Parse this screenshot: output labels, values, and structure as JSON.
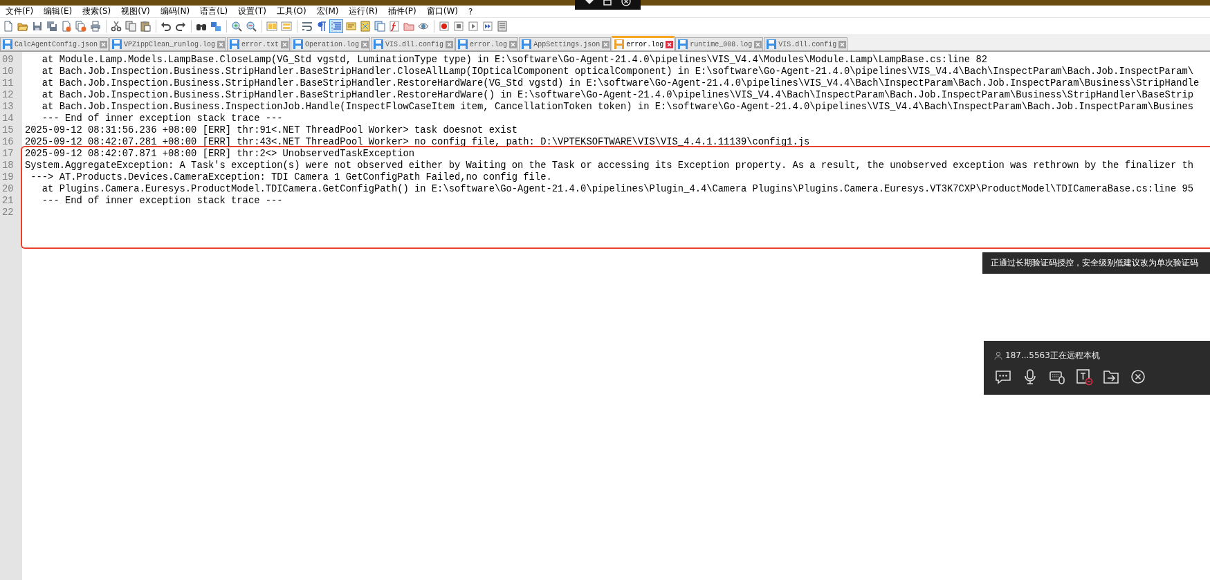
{
  "menu": [
    "文件(F)",
    "编辑(E)",
    "搜索(S)",
    "视图(V)",
    "编码(N)",
    "语言(L)",
    "设置(T)",
    "工具(O)",
    "宏(M)",
    "运行(R)",
    "插件(P)",
    "窗口(W)",
    "?"
  ],
  "toolbar": [
    {
      "pressed": false
    },
    {
      "pressed": false
    },
    {
      "pressed": false
    },
    {
      "pressed": false
    },
    {
      "pressed": false
    },
    {
      "pressed": false
    },
    {
      "pressed": false
    },
    {
      "pressed": false
    },
    {
      "pressed": false
    },
    {
      "pressed": false
    },
    {
      "pressed": false
    },
    {
      "pressed": false
    },
    {
      "pressed": false
    },
    {
      "pressed": false
    },
    {
      "pressed": false
    },
    {
      "pressed": false
    },
    {
      "pressed": false
    },
    {
      "pressed": false
    },
    {
      "pressed": false
    },
    {
      "pressed": false
    },
    {
      "pressed": true
    },
    {
      "pressed": false
    },
    {
      "pressed": false
    },
    {
      "pressed": false
    },
    {
      "pressed": false
    },
    {
      "pressed": false
    },
    {
      "pressed": false
    },
    {
      "pressed": false
    },
    {
      "pressed": false
    },
    {
      "pressed": false
    },
    {
      "pressed": false
    },
    {
      "pressed": false
    }
  ],
  "tabs": [
    {
      "label": "CalcAgentConfig.json",
      "selected": false
    },
    {
      "label": "VPZippClean_runlog.log",
      "selected": false
    },
    {
      "label": "error.txt",
      "selected": false
    },
    {
      "label": "Operation.log",
      "selected": false
    },
    {
      "label": "VIS.dll.config",
      "selected": false
    },
    {
      "label": "error.log",
      "selected": false
    },
    {
      "label": "AppSettings.json",
      "selected": false
    },
    {
      "label": "error.log",
      "selected": true
    },
    {
      "label": "runtime_008.log",
      "selected": false
    },
    {
      "label": "VIS.dll.config",
      "selected": false
    }
  ],
  "editor": {
    "lines": [
      {
        "number": "09",
        "text": "   at Module.Lamp.Models.LampBase.CloseLamp(VG_Std vgstd, LuminationType type) in E:\\software\\Go-Agent-21.4.0\\pipelines\\VIS_V4.4\\Modules\\Module.Lamp\\LampBase.cs:line 82"
      },
      {
        "number": "10",
        "text": "   at Bach.Job.Inspection.Business.StripHandler.BaseStripHandler.CloseAllLamp(IOpticalComponent opticalComponent) in E:\\software\\Go-Agent-21.4.0\\pipelines\\VIS_V4.4\\Bach\\InspectParam\\Bach.Job.InspectParam\\"
      },
      {
        "number": "11",
        "text": "   at Bach.Job.Inspection.Business.StripHandler.BaseStripHandler.RestoreHardWare(VG_Std vgstd) in E:\\software\\Go-Agent-21.4.0\\pipelines\\VIS_V4.4\\Bach\\InspectParam\\Bach.Job.InspectParam\\Business\\StripHandle"
      },
      {
        "number": "12",
        "text": "   at Bach.Job.Inspection.Business.StripHandler.BaseStripHandler.RestoreHardWare() in E:\\software\\Go-Agent-21.4.0\\pipelines\\VIS_V4.4\\Bach\\InspectParam\\Bach.Job.InspectParam\\Business\\StripHandler\\BaseStrip"
      },
      {
        "number": "13",
        "text": "   at Bach.Job.Inspection.Business.InspectionJob.Handle(InspectFlowCaseItem item, CancellationToken token) in E:\\software\\Go-Agent-21.4.0\\pipelines\\VIS_V4.4\\Bach\\InspectParam\\Bach.Job.InspectParam\\Busines"
      },
      {
        "number": "14",
        "text": "   --- End of inner exception stack trace ---"
      },
      {
        "number": "15",
        "text": "2025-09-12 08:31:56.236 +08:00 [ERR] thr:91<.NET ThreadPool Worker> task doesnot exist"
      },
      {
        "number": "16",
        "text": "2025-09-12 08:42:07.281 +08:00 [ERR] thr:43<.NET ThreadPool Worker> no config file, path: D:\\VPTEKSOFTWARE\\VIS\\VIS_4.4.1.11139\\config1.js"
      },
      {
        "number": "17",
        "text": "2025-09-12 08:42:07.871 +08:00 [ERR] thr:2<> UnobservedTaskException"
      },
      {
        "number": "18",
        "text": "System.AggregateException: A Task's exception(s) were not observed either by Waiting on the Task or accessing its Exception property. As a result, the unobserved exception was rethrown by the finalizer th"
      },
      {
        "number": "19",
        "text": " ---> AT.Products.Devices.CameraException: TDI Camera 1 GetConfigPath Failed,no config file."
      },
      {
        "number": "20",
        "text": "   at Plugins.Camera.Euresys.ProductModel.TDICamera.GetConfigPath() in E:\\software\\Go-Agent-21.4.0\\pipelines\\Plugin_4.4\\Camera Plugins\\Plugins.Camera.Euresys.VT3K7CXP\\ProductModel\\TDICameraBase.cs:line 95"
      },
      {
        "number": "21",
        "text": "   --- End of inner exception stack trace ---"
      },
      {
        "number": "22"
      }
    ]
  },
  "notice": {
    "text": "正通过长期验证码授控，安全级别低建议改为单次验证码"
  },
  "remote_panel": {
    "status": "187...5563正在远程本机"
  }
}
